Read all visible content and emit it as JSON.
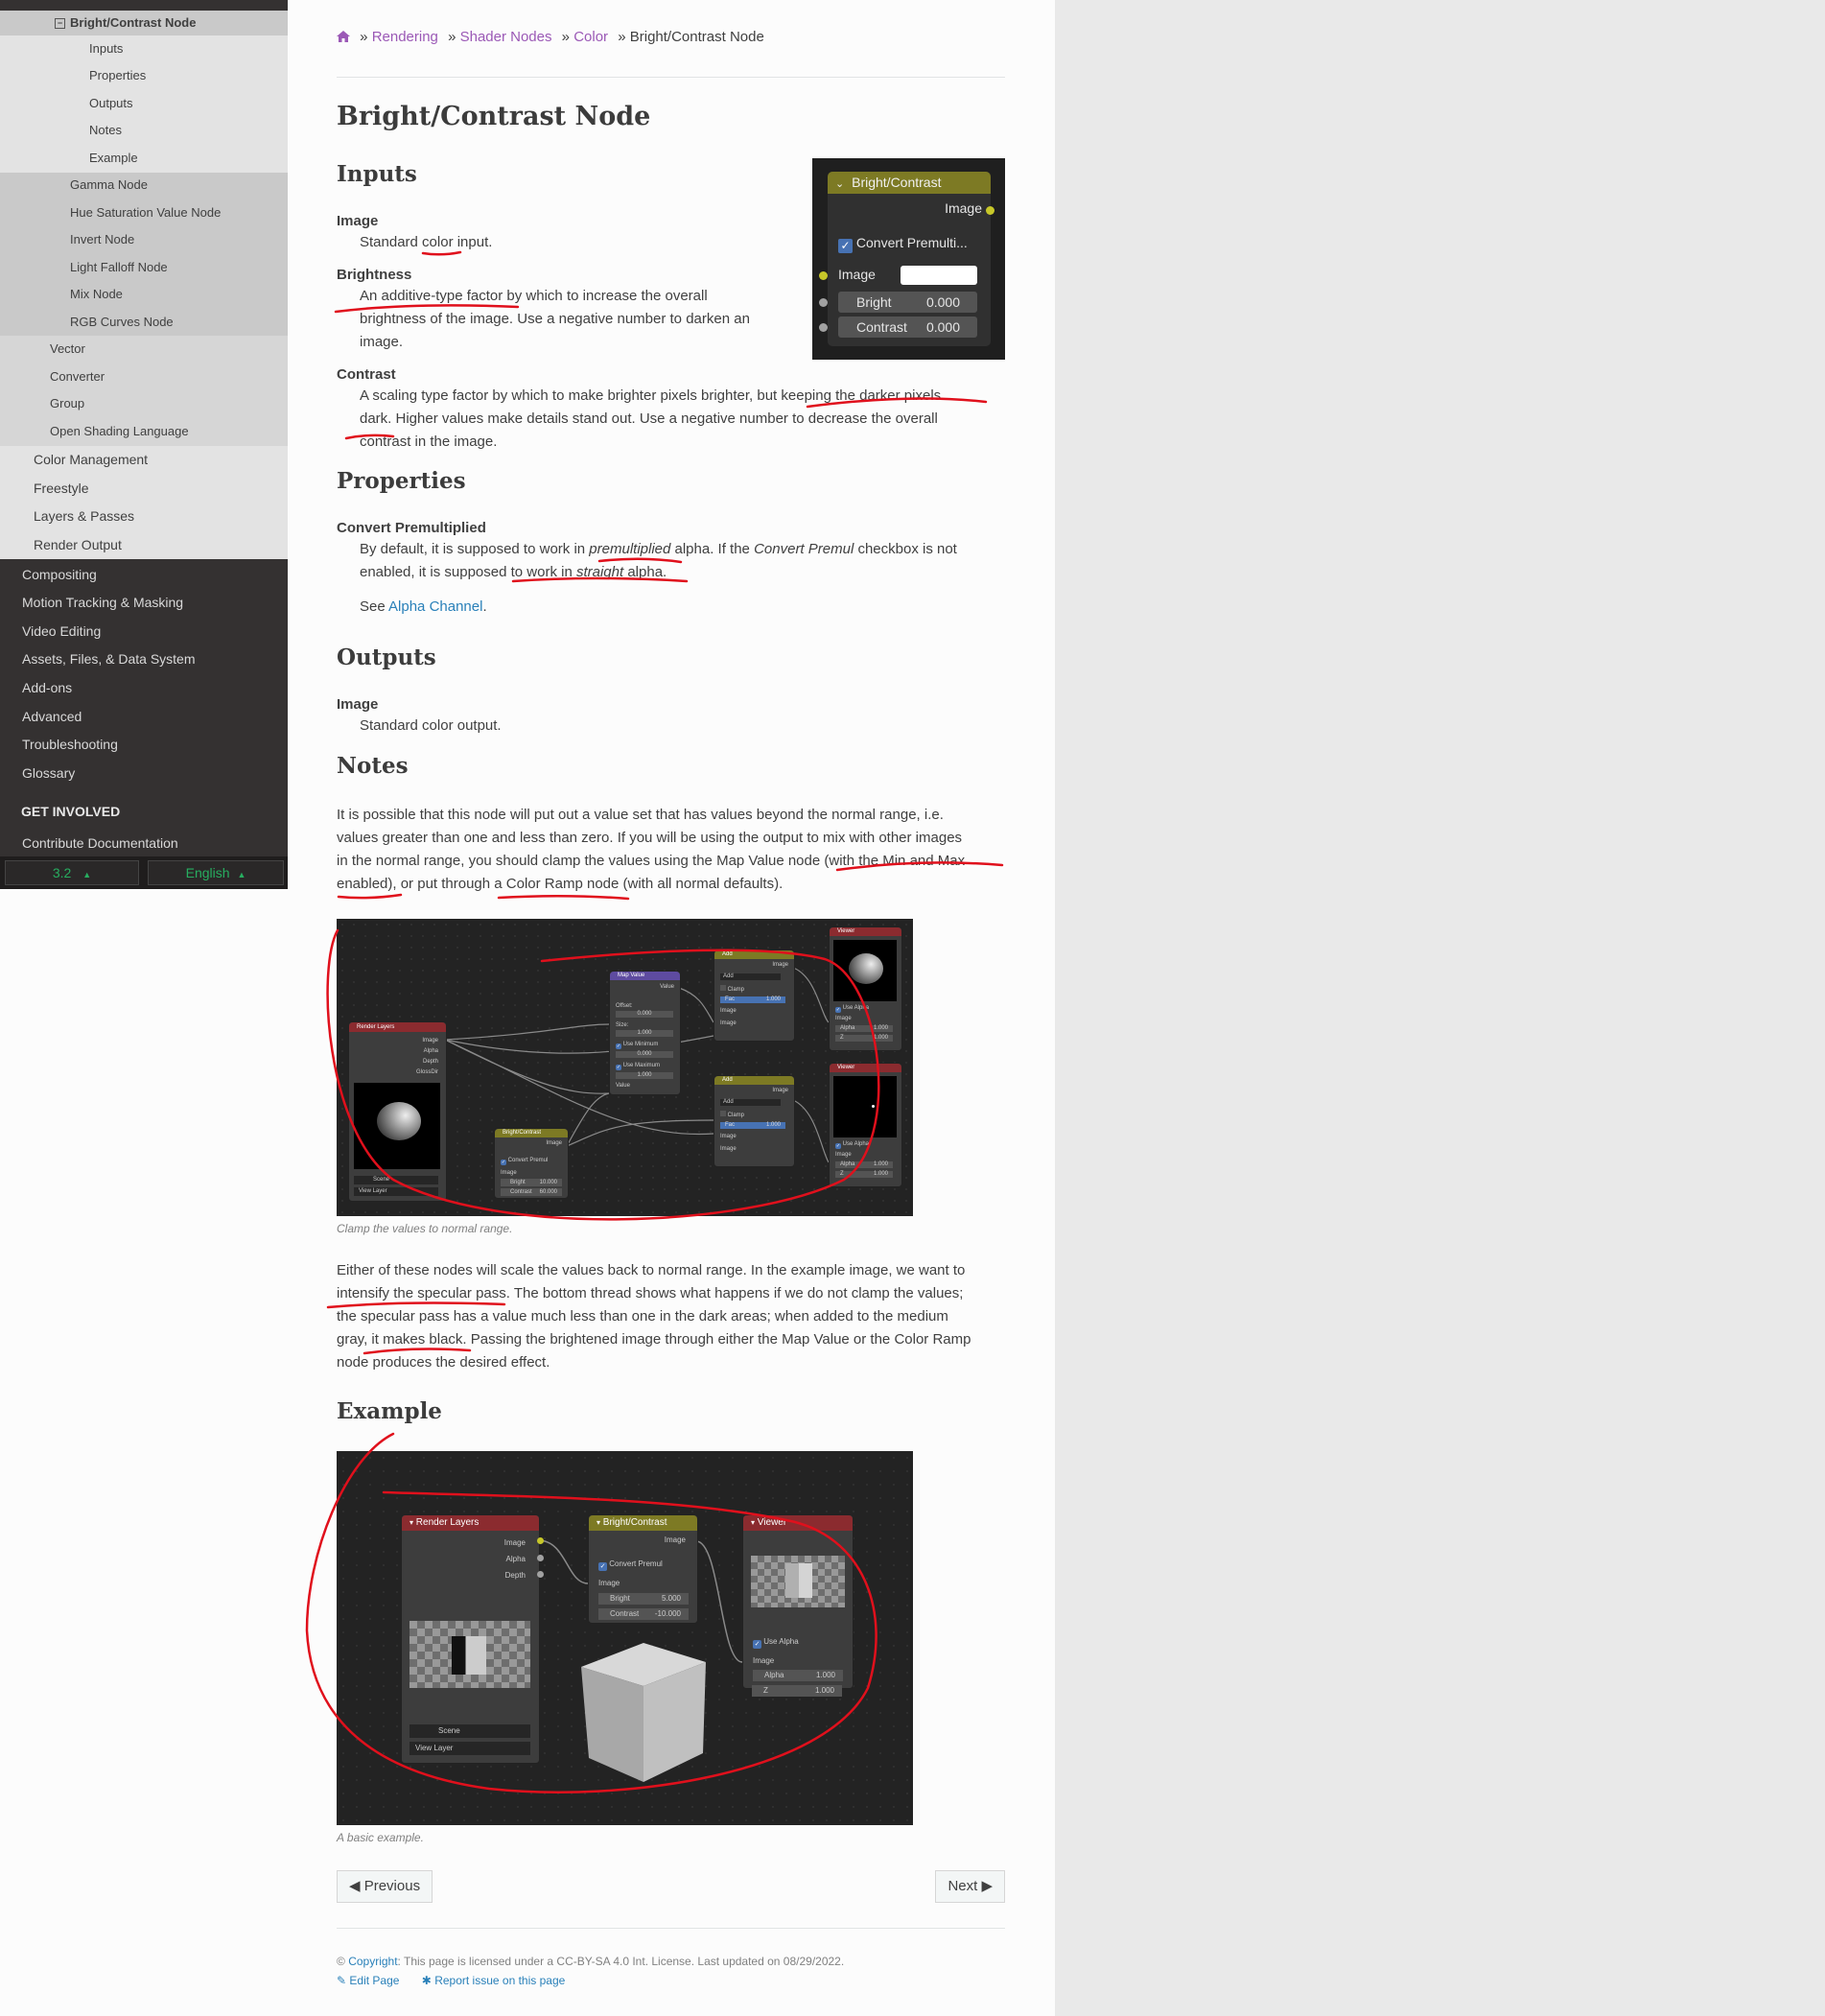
{
  "sidebar": {
    "items": [
      {
        "label": "Bright/Contrast Node",
        "current": true
      },
      {
        "label": "Inputs"
      },
      {
        "label": "Properties"
      },
      {
        "label": "Outputs"
      },
      {
        "label": "Notes"
      },
      {
        "label": "Example"
      },
      {
        "label": "Gamma Node"
      },
      {
        "label": "Hue Saturation Value Node"
      },
      {
        "label": "Invert Node"
      },
      {
        "label": "Light Falloff Node"
      },
      {
        "label": "Mix Node"
      },
      {
        "label": "RGB Curves Node"
      },
      {
        "label": "Vector"
      },
      {
        "label": "Converter"
      },
      {
        "label": "Group"
      },
      {
        "label": "Open Shading Language"
      },
      {
        "label": "Color Management"
      },
      {
        "label": "Freestyle"
      },
      {
        "label": "Layers & Passes"
      },
      {
        "label": "Render Output"
      },
      {
        "label": "Compositing"
      },
      {
        "label": "Motion Tracking & Masking"
      },
      {
        "label": "Video Editing"
      },
      {
        "label": "Assets, Files, & Data System"
      },
      {
        "label": "Add-ons"
      },
      {
        "label": "Advanced"
      },
      {
        "label": "Troubleshooting"
      },
      {
        "label": "Glossary"
      }
    ],
    "get_involved_heading": "GET INVOLVED",
    "contribute_label": "Contribute Documentation",
    "version": "3.2",
    "language": "English"
  },
  "breadcrumb": {
    "items": [
      "Rendering",
      "Shader Nodes",
      "Color"
    ],
    "current": "Bright/Contrast Node",
    "separator": "»"
  },
  "page": {
    "title": "Bright/Contrast Node",
    "inputs": {
      "heading": "Inputs",
      "image_term": "Image",
      "image_desc": "Standard color input.",
      "brightness_term": "Brightness",
      "brightness_desc_1": "An additive-type factor by which to increase the overall",
      "brightness_desc_2": "brightness of the image. Use a negative number to darken an",
      "brightness_desc_3": "image.",
      "contrast_term": "Contrast",
      "contrast_desc_1": "A scaling type factor by which to make brighter pixels brighter, but keeping the darker pixels",
      "contrast_desc_2": "dark. Higher values make details stand out. Use a negative number to decrease the overall",
      "contrast_desc_3": "contrast in the image."
    },
    "properties": {
      "heading": "Properties",
      "term": "Convert Premultiplied",
      "desc_a": "By default, it is supposed to work in ",
      "desc_b": "premultiplied",
      "desc_c": " alpha. If the ",
      "desc_d": "Convert Premul",
      "desc_e": " checkbox is not",
      "desc_2a": "enabled, it is supposed to work in ",
      "desc_2b": "straight",
      "desc_2c": " alpha.",
      "see_prefix": "See ",
      "see_link": "Alpha Channel",
      "see_suffix": "."
    },
    "outputs": {
      "heading": "Outputs",
      "term": "Image",
      "desc": "Standard color output."
    },
    "notes": {
      "heading": "Notes",
      "p1_l1": "It is possible that this node will put out a value set that has values beyond the normal range, i.e.",
      "p1_l2": "values greater than one and less than zero. If you will be using the output to mix with other images",
      "p1_l3": "in the normal range, you should clamp the values using the Map Value node (with the Min and Max",
      "p1_l4": "enabled), or put through a Color Ramp node (with all normal defaults).",
      "caption1": "Clamp the values to normal range.",
      "p2_l1": "Either of these nodes will scale the values back to normal range. In the example image, we want to",
      "p2_l2": "intensify the specular pass. The bottom thread shows what happens if we do not clamp the values;",
      "p2_l3": "the specular pass has a value much less than one in the dark areas; when added to the medium",
      "p2_l4": "gray, it makes black. Passing the brightened image through either the Map Value or the Color Ramp",
      "p2_l5": "node produces the desired effect."
    },
    "example": {
      "heading": "Example",
      "caption": "A basic example."
    }
  },
  "node_panel": {
    "title": "Bright/Contrast",
    "output_image": "Image",
    "convert_label": "Convert Premulti...",
    "input_image": "Image",
    "bright_label": "Bright",
    "bright_value": "0.000",
    "contrast_label": "Contrast",
    "contrast_value": "0.000"
  },
  "example_nodes": {
    "render_layers": "Render Layers",
    "rl_image": "Image",
    "rl_alpha": "Alpha",
    "rl_depth": "Depth",
    "rl_scene": "Scene",
    "rl_view_layer": "View Layer",
    "bc_title": "Bright/Contrast",
    "bc_image_out": "Image",
    "bc_convert": "Convert Premul",
    "bc_image_in": "Image",
    "bc_bright": "Bright",
    "bc_bright_val": "5.000",
    "bc_contrast": "Contrast",
    "bc_contrast_val": "-10.000",
    "viewer_title": "Viewer",
    "viewer_use_alpha": "Use Alpha",
    "viewer_image": "Image",
    "viewer_alpha": "Alpha",
    "viewer_alpha_val": "1.000",
    "viewer_z": "Z",
    "viewer_z_val": "1.000"
  },
  "clamp_nodes": {
    "render_layers": "Render Layers",
    "rl_sockets": [
      "Image",
      "Alpha",
      "Depth",
      "GlossDir"
    ],
    "rl_scene": "Scene",
    "rl_view_layer": "View Layer",
    "bc_title": "Bright/Contrast",
    "bc_image": "Image",
    "bc_convert": "Convert Premul",
    "bc_bright": "Bright",
    "bc_bright_val": "10.000",
    "bc_contrast": "Contrast",
    "bc_contrast_val": "60.000",
    "map_title": "Map Value",
    "map_value": "Value",
    "map_offset": "Offset:",
    "map_offset_val": "0.000",
    "map_size": "Size:",
    "map_size_val": "1.000",
    "map_use_min": "Use Minimum",
    "map_min_val": "0.000",
    "map_use_max": "Use Maximum",
    "map_max_val": "1.000",
    "map_value_in": "Value",
    "add_title": "Add",
    "add_image": "Image",
    "add_mode": "Add",
    "add_clamp": "Clamp",
    "add_fac": "Fac",
    "add_fac_val": "1.000",
    "viewer_title": "Viewer",
    "viewer_use_alpha": "Use Alpha",
    "viewer_image": "Image",
    "viewer_alpha": "Alpha",
    "viewer_alpha_val": "1.000",
    "viewer_z": "Z",
    "viewer_z_val": "1.000"
  },
  "nav": {
    "previous": "Previous",
    "next": "Next"
  },
  "footer": {
    "copyright_prefix": "© ",
    "copyright_link": "Copyright",
    "copyright_text": ": This page is licensed under a CC-BY-SA 4.0 Int. License. Last updated on 08/29/2022.",
    "edit_page": "Edit Page",
    "report_issue": "Report issue on this page"
  },
  "colors": {
    "link": "#2980b9",
    "breadcrumb_link": "#9b59b6",
    "annotation": "#e0101c",
    "node_yellow_header": "#7d7a24",
    "node_red_header": "#8b2b2f",
    "node_purple_header": "#5e4ba0",
    "socket_yellow": "#c7c729",
    "socket_gray": "#a1a1a1"
  }
}
